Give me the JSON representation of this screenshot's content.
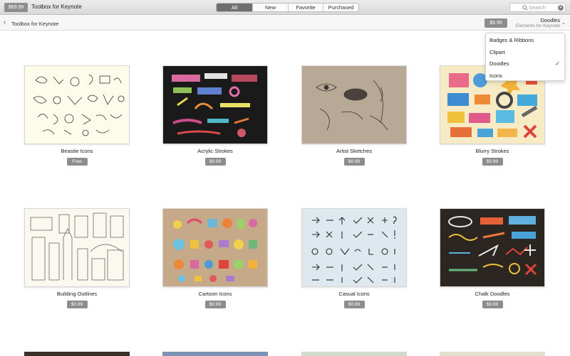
{
  "toolbar": {
    "price": "$69.99",
    "app_title": "Toolbox for Keynote",
    "segments": [
      "All",
      "New",
      "Favorite",
      "Purchased"
    ],
    "active_segment": "All",
    "search_placeholder": "Search"
  },
  "subheader": {
    "breadcrumb": "Toolbox for Keynote",
    "price": "$9.99",
    "filter_title": "Doodles",
    "filter_subtitle": "Elements for Keynote"
  },
  "dropdown": {
    "items": [
      "Badges & Ribbons",
      "Clipart",
      "Doodles",
      "Icons"
    ],
    "selected": "Doodles"
  },
  "cards": [
    {
      "title": "Beastie Icons",
      "price": "Free",
      "bg": "#fdfbea"
    },
    {
      "title": "Acrylic Strokes",
      "price": "$0.99",
      "bg": "#1a1a1a"
    },
    {
      "title": "Artist Sketches",
      "price": "$0.99",
      "bg": "#b7a995"
    },
    {
      "title": "Blurry Strokes",
      "price": "$0.99",
      "bg": "#f7ebc6"
    },
    {
      "title": "Building Outlines",
      "price": "$0.99",
      "bg": "#faf8ef"
    },
    {
      "title": "Cartoon Icons",
      "price": "$0.99",
      "bg": "#c5a988"
    },
    {
      "title": "Casual Icons",
      "price": "$0.99",
      "bg": "#dde9ee"
    },
    {
      "title": "Chalk Doodles",
      "price": "$0.99",
      "bg": "#2b2622"
    }
  ],
  "colors": {
    "accent_pill": "#8d8d8d",
    "segment_active": "#6f6f6f"
  }
}
